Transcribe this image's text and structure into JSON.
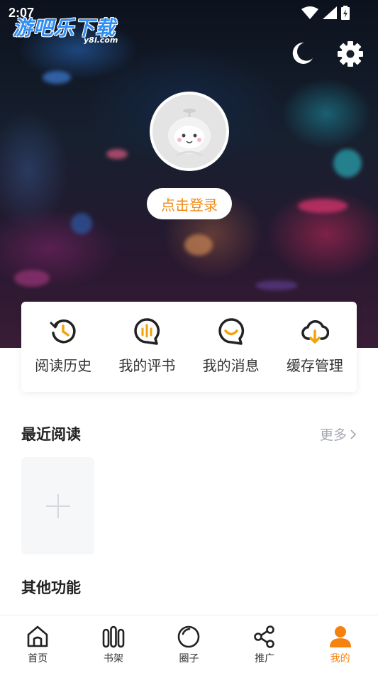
{
  "status_bar": {
    "time": "2:07"
  },
  "watermark": {
    "title": "游吧乐下载",
    "site": "y8l.com"
  },
  "profile": {
    "login_label": "点击登录"
  },
  "quick_actions": [
    {
      "label": "阅读历史",
      "icon": "history-icon"
    },
    {
      "label": "我的评书",
      "icon": "review-icon"
    },
    {
      "label": "我的消息",
      "icon": "message-icon"
    },
    {
      "label": "缓存管理",
      "icon": "cloud-download-icon"
    }
  ],
  "recent": {
    "title": "最近阅读",
    "more_label": "更多"
  },
  "other": {
    "title": "其他功能"
  },
  "bottom_nav": [
    {
      "label": "首页",
      "icon": "home-icon",
      "active": false
    },
    {
      "label": "书架",
      "icon": "bookshelf-icon",
      "active": false
    },
    {
      "label": "圈子",
      "icon": "circle-icon",
      "active": false
    },
    {
      "label": "推广",
      "icon": "share-icon",
      "active": false
    },
    {
      "label": "我的",
      "icon": "user-icon",
      "active": true
    }
  ],
  "colors": {
    "accent": "#f5820f",
    "login_text": "#f08a16"
  }
}
